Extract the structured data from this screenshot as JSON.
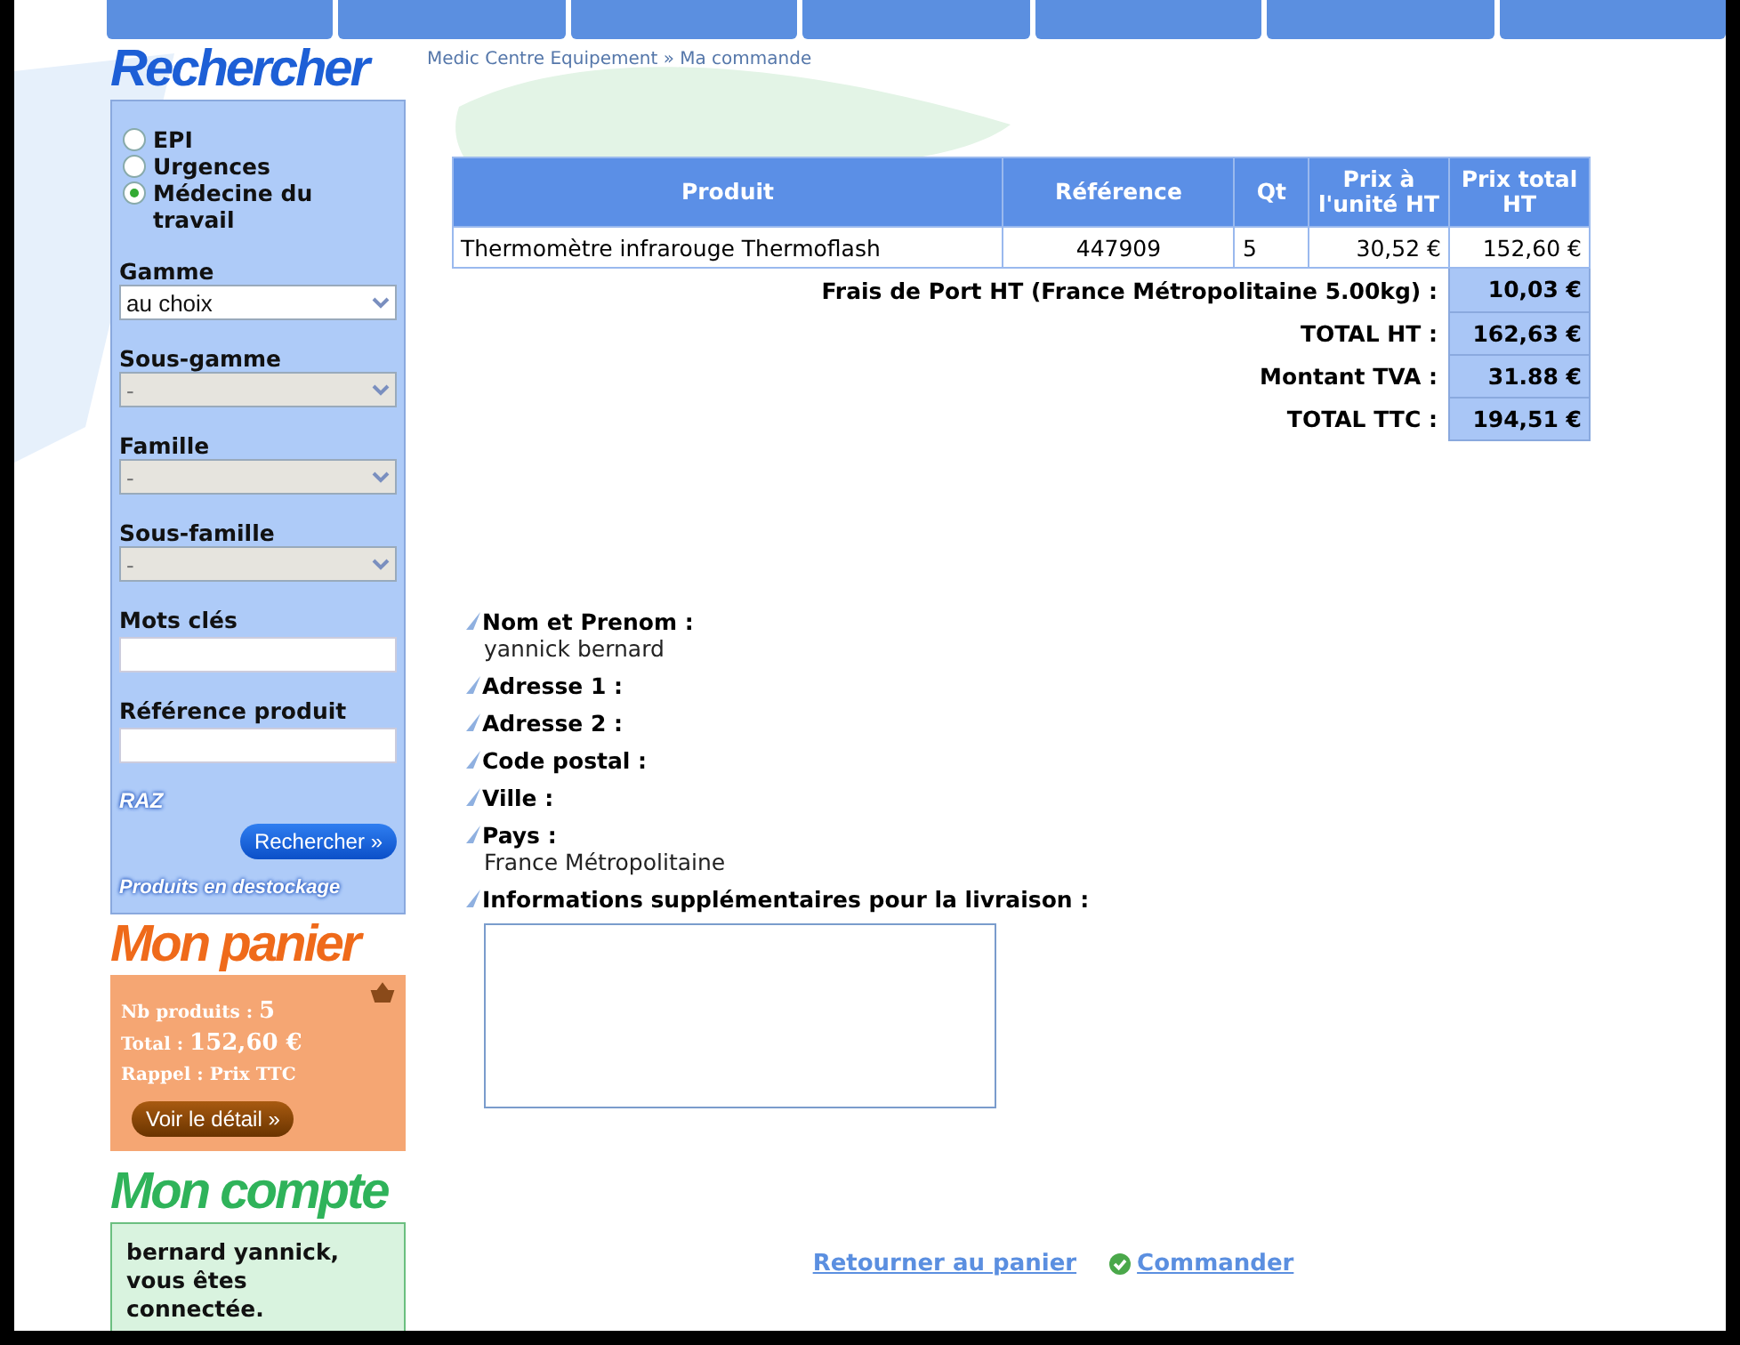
{
  "breadcrumb": "Medic Centre Equipement » Ma commande",
  "search": {
    "title": "Rechercher",
    "categories": [
      {
        "label": "EPI",
        "selected": false
      },
      {
        "label": "Urgences",
        "selected": false
      },
      {
        "label": "Médecine du travail",
        "selected": true
      }
    ],
    "selects": [
      {
        "label": "Gamme",
        "value": "au choix",
        "disabled": false
      },
      {
        "label": "Sous-gamme",
        "value": "-",
        "disabled": true
      },
      {
        "label": "Famille",
        "value": "-",
        "disabled": true
      },
      {
        "label": "Sous-famille",
        "value": "-",
        "disabled": true
      }
    ],
    "inputs": [
      {
        "label": "Mots clés"
      },
      {
        "label": "Référence produit"
      }
    ],
    "reset": "RAZ",
    "button": "Rechercher »",
    "clearance": "Produits en destockage"
  },
  "cart": {
    "title": "Mon panier",
    "count_label": "Nb produits :",
    "count": "5",
    "total_label": "Total :",
    "total": "152,60 €",
    "note": "Rappel : Prix TTC",
    "button": "Voir le détail »"
  },
  "account": {
    "title": "Mon compte",
    "message": "bernard yannick, vous êtes connectée."
  },
  "table": {
    "columns": [
      "Produit",
      "Référence",
      "Qt",
      "Prix à l'unité HT",
      "Prix total HT"
    ],
    "rows": [
      [
        "Thermomètre infrarouge Thermoflash",
        "447909",
        "5",
        "30,52 €",
        "152,60 €"
      ]
    ],
    "summary": [
      {
        "label": "Frais de Port HT (France Métropolitaine 5.00kg) :",
        "value": "10,03 €"
      },
      {
        "label": "TOTAL HT :",
        "value": "162,63 €"
      },
      {
        "label": "Montant TVA :",
        "value": "31.88 €"
      },
      {
        "label": "TOTAL TTC :",
        "value": "194,51 €"
      }
    ]
  },
  "address": [
    {
      "label": "Nom et Prenom :",
      "value": "yannick bernard"
    },
    {
      "label": "Adresse 1 :"
    },
    {
      "label": "Adresse 2 :"
    },
    {
      "label": "Code postal :"
    },
    {
      "label": "Ville :"
    },
    {
      "label": "Pays :",
      "value": "France Métropolitaine"
    },
    {
      "label": "Informations supplémentaires pour la livraison :"
    }
  ],
  "actions": {
    "back": "Retourner au panier",
    "order": "Commander"
  }
}
